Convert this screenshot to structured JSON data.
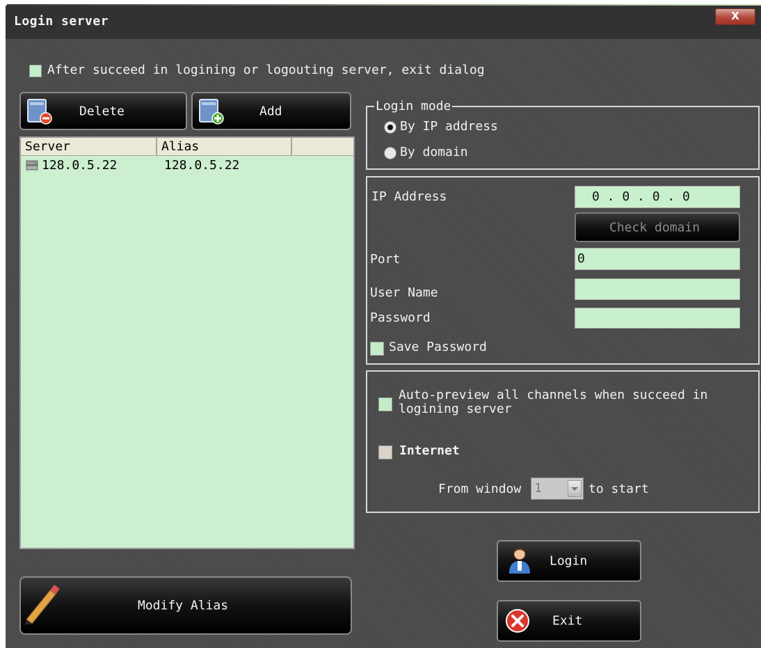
{
  "window": {
    "title": "Login server",
    "close_label": "X"
  },
  "exit_dialog_option": {
    "label": "After succeed in logining or logouting server, exit dialog",
    "checked": false
  },
  "toolbar": {
    "delete_label": "Delete",
    "add_label": "Add"
  },
  "server_list": {
    "columns": [
      "Server",
      "Alias"
    ],
    "rows": [
      {
        "server": "128.0.5.22",
        "alias": "128.0.5.22"
      }
    ]
  },
  "modify_alias_label": "Modify Alias",
  "login_mode": {
    "legend": "Login mode",
    "options": [
      {
        "label": "By IP address",
        "selected": true
      },
      {
        "label": "By domain",
        "selected": false
      }
    ]
  },
  "connection": {
    "ip_label": "IP Address",
    "ip_value": "0  .  0  .  0  .  0",
    "check_domain_label": "Check domain",
    "port_label": "Port",
    "port_value": "0",
    "username_label": "User Name",
    "username_value": "",
    "password_label": "Password",
    "password_value": "",
    "save_password_label": "Save Password",
    "save_password_checked": false
  },
  "options": {
    "autopreview_label_line1": "Auto-preview all channels when succeed in",
    "autopreview_label_line2": "logining server",
    "autopreview_checked": false,
    "internet_label": "Internet",
    "internet_checked": false,
    "from_window_label": "From window",
    "from_window_value": "1",
    "to_start_label": "to start"
  },
  "login_label": "Login",
  "exit_label": "Exit",
  "colors": {
    "panel": "#4b4b4b",
    "field": "#c9f0cd",
    "list": "#ccefd0"
  }
}
